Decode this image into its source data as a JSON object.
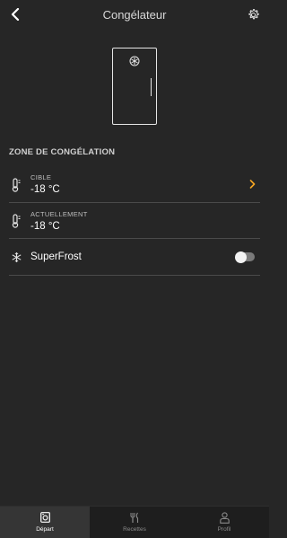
{
  "header": {
    "title": "Congélateur",
    "back_icon": "chevron-left-icon",
    "settings_icon": "gear-icon"
  },
  "appliance": {
    "icon": "snowflake-icon"
  },
  "zone": {
    "section_title": "ZONE DE CONGÉLATION",
    "target": {
      "label": "CIBLE",
      "value": "-18 °C",
      "icon": "thermometer-icon",
      "chevron_color": "#f5a623"
    },
    "current": {
      "label": "ACTUELLEMENT",
      "value": "-18 °C",
      "icon": "thermometer-icon"
    },
    "superfrost": {
      "label": "SuperFrost",
      "icon": "snowflake-icon",
      "enabled": false
    }
  },
  "tabbar": {
    "tabs": [
      {
        "label": "Départ",
        "icon": "appliance-icon",
        "active": true
      },
      {
        "label": "Recettes",
        "icon": "cutlery-icon",
        "active": false
      },
      {
        "label": "Profil",
        "icon": "person-icon",
        "active": false
      }
    ]
  },
  "colors": {
    "background": "#262626",
    "accent": "#f5a623",
    "tabbar": "#1e1e1e"
  }
}
